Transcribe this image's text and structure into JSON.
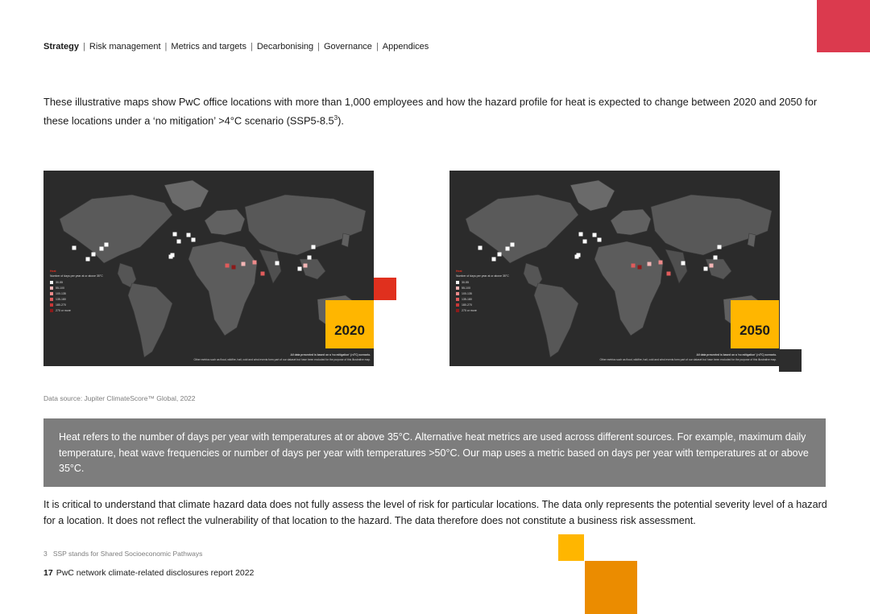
{
  "nav": {
    "active": "Strategy",
    "items": [
      "Risk management",
      "Metrics and targets",
      "Decarbonising",
      "Governance",
      "Appendices"
    ]
  },
  "intro": {
    "text": "These illustrative maps show PwC office locations with more than 1,000 employees and how the hazard profile for heat is expected to change between 2020 and 2050 for these locations under a ‘no mitigation’ >4°C scenario (SSP5-8.5",
    "sup": "3",
    "tail": ")."
  },
  "maps": [
    {
      "year": "2020",
      "legend_title": "Heat",
      "legend_subtitle": "Number of days per year at or above 35°C",
      "legend_items": [
        "30-55",
        "55-100",
        "100-135",
        "135-180",
        "180-270",
        "270 or more"
      ],
      "note_line1": "All data presented is based on a 'no mitigation' (>4°C) scenario.",
      "note_line2": "Other metrics such as flood, wildfire, hail, cold and wind events form part of our dataset but have been excluded for the purpose of this illustrative map."
    },
    {
      "year": "2050",
      "legend_title": "Heat",
      "legend_subtitle": "Number of days per year at or above 35°C",
      "legend_items": [
        "30-55",
        "55-100",
        "100-135",
        "135-180",
        "180-270",
        "270 or more"
      ],
      "note_line1": "All data presented is based on a 'no mitigation' (>4°C) scenario.",
      "note_line2": "Other metrics such as flood, wildfire, hail, cold and wind events form part of our dataset but have been excluded for the purpose of this illustrative map."
    }
  ],
  "legend_colors": [
    "#f2f2f2",
    "#f4b6b6",
    "#ec8a8a",
    "#e05b5b",
    "#c93636",
    "#8c1a1a"
  ],
  "source": "Data source: Jupiter ClimateScore™ Global, 2022",
  "callout": "Heat refers to the number of days per year with temperatures at or above 35°C.  Alternative heat metrics are used across different sources. For example, maximum daily temperature, heat wave frequencies or number of days per year with temperatures >50°C. Our map uses a metric based on days per year with temperatures at or above 35°C.",
  "critical": "It is critical to understand that climate hazard data does not fully assess the level of risk for particular locations. The data only represents the potential severity level of a hazard for a location. It does not reflect the vulnerability of that location to the hazard. The data therefore does not constitute a business risk assessment.",
  "footnote": {
    "number": "3",
    "text": "SSP stands for Shared Socioeconomic Pathways"
  },
  "footer": {
    "page": "17",
    "title": "PwC network climate-related disclosures report 2022"
  },
  "colors": {
    "pwc_red": "#e0301e",
    "pwc_rose": "#db3a4e",
    "pwc_yellow": "#ffb600",
    "pwc_orange": "#eb8c00",
    "dark_grey": "#2d2d2d",
    "callout_grey": "#7d7d7d"
  }
}
